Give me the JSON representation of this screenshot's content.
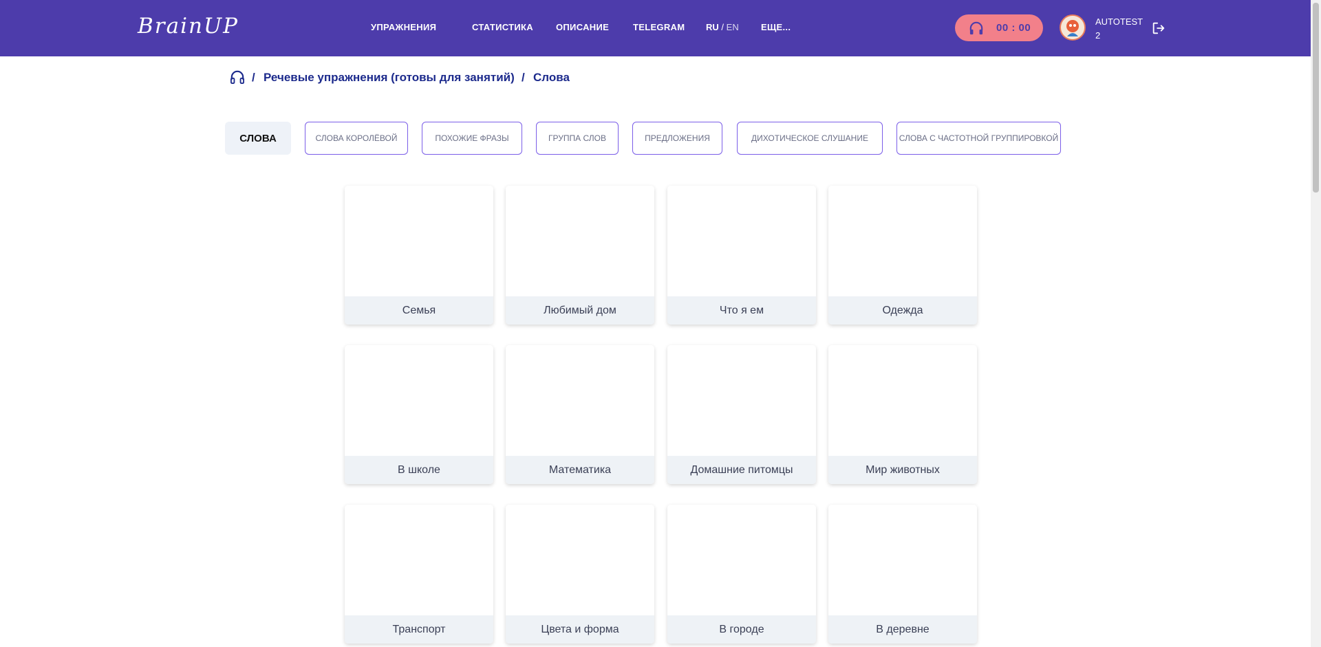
{
  "app": {
    "logo_text": "BrainUP"
  },
  "nav": {
    "items": [
      {
        "label": "УПРАЖНЕНИЯ"
      },
      {
        "label": "СТАТИСТИКА"
      },
      {
        "label": "ОПИСАНИЕ"
      },
      {
        "label": "TELEGRAM"
      }
    ],
    "lang_ru": "RU",
    "lang_sep": "/",
    "lang_en": "EN",
    "more": "ЕЩЕ..."
  },
  "timer": {
    "value": "00 : 00",
    "icon": "headphones-icon"
  },
  "user": {
    "name_line1": "AUTOTEST",
    "name_line2": "2"
  },
  "breadcrumb": {
    "sep": "/",
    "group": "Речевые упражнения (готовы для занятий)",
    "current": "Слова"
  },
  "tabs": [
    {
      "label": "Слова",
      "active": true
    },
    {
      "label": "Слова Королёвой"
    },
    {
      "label": "Похожие фразы"
    },
    {
      "label": "Группа слов"
    },
    {
      "label": "Предложения"
    },
    {
      "label": "Дихотическое слушание"
    },
    {
      "label": "Слова с частотной группировкой"
    }
  ],
  "cards": [
    {
      "label": "Семья"
    },
    {
      "label": "Любимый дом"
    },
    {
      "label": "Что я ем"
    },
    {
      "label": "Одежда"
    },
    {
      "label": "В школе"
    },
    {
      "label": "Математика"
    },
    {
      "label": "Домашние питомцы"
    },
    {
      "label": "Мир животных"
    },
    {
      "label": "Транспорт"
    },
    {
      "label": "Цвета и форма"
    },
    {
      "label": "В городе"
    },
    {
      "label": "В деревне"
    }
  ],
  "colors": {
    "header_bg": "#4d3cab",
    "timer_bg": "#f2808a",
    "breadcrumb": "#1c2a8c",
    "tab_border": "#7a5de8"
  }
}
